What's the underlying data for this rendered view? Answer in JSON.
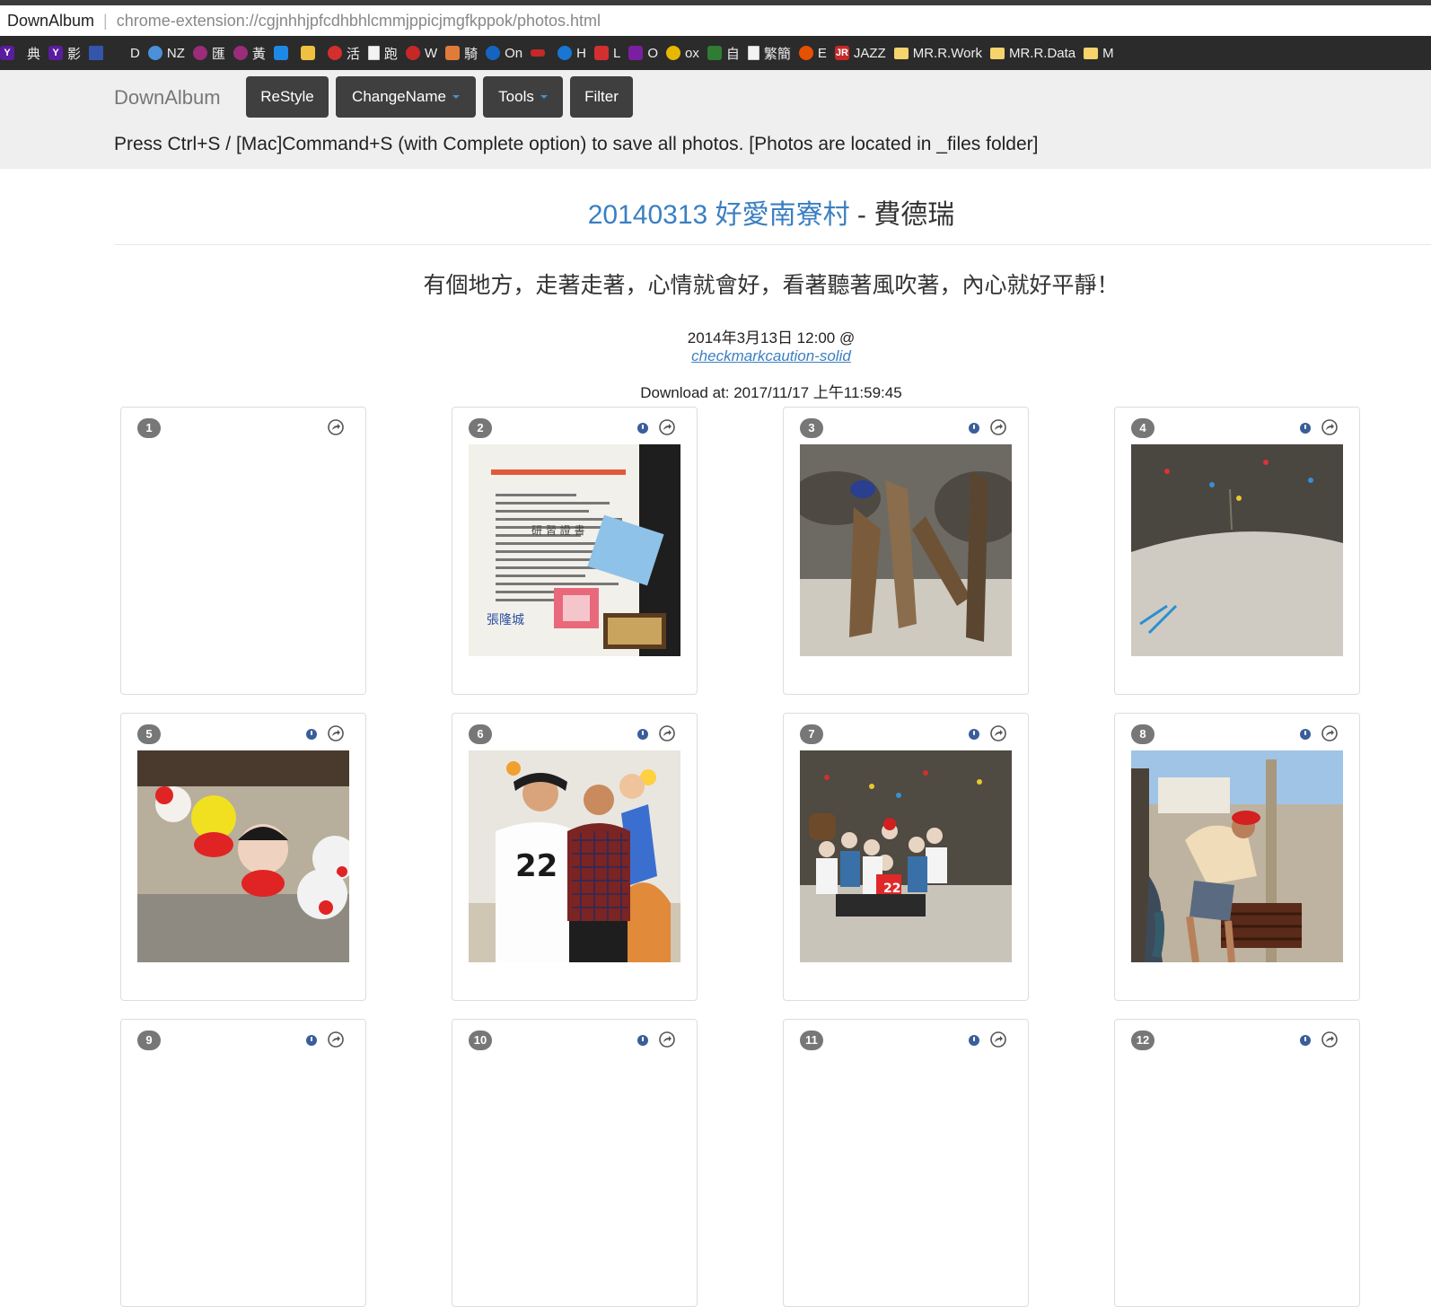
{
  "browser": {
    "site_name": "DownAlbum",
    "url": "chrome-extension://cgjnhhjpfcdhbhlcmmjppicjmgfkppok/photos.html",
    "bookmarks": [
      {
        "label": "典",
        "icon": "yahoo-icon",
        "color": "#5b1d9f"
      },
      {
        "label": "影",
        "icon": "yahoo-icon",
        "color": "#5b1d9f"
      },
      {
        "label": "",
        "icon": "flag-icon",
        "color": "#3355aa"
      },
      {
        "label": "D",
        "icon": "blank-icon",
        "color": "#2b2b2b"
      },
      {
        "label": "NZ",
        "icon": "cloud-icon",
        "color": "#4a90d9"
      },
      {
        "label": "匯",
        "icon": "circle-char-icon",
        "color": "#9b2c7a"
      },
      {
        "label": "黃",
        "icon": "circle-char-icon",
        "color": "#9b2c7a"
      },
      {
        "label": "",
        "icon": "cube-icon",
        "color": "#1e88e5"
      },
      {
        "label": "",
        "icon": "card-icon",
        "color": "#f0c040"
      },
      {
        "label": "活",
        "icon": "target-icon",
        "color": "#d32f2f"
      },
      {
        "label": "跑",
        "icon": "page-icon",
        "color": "#f3f3f3"
      },
      {
        "label": "W",
        "icon": "shield-icon",
        "color": "#c62828"
      },
      {
        "label": "騎",
        "icon": "rider-icon",
        "color": "#e07b39"
      },
      {
        "label": "On",
        "icon": "onedrive-icon",
        "color": "#1565c0"
      },
      {
        "label": "",
        "icon": "red-flag-icon",
        "color": "#c62828"
      },
      {
        "label": "H",
        "icon": "globe-icon",
        "color": "#1976d2"
      },
      {
        "label": "L",
        "icon": "live-icon",
        "color": "#d32f2f"
      },
      {
        "label": "O",
        "icon": "onenote-icon",
        "color": "#7b1fa2"
      },
      {
        "label": "ox",
        "icon": "dots-icon",
        "color": "#e6b800"
      },
      {
        "label": "自",
        "icon": "green-icon",
        "color": "#2e7d32"
      },
      {
        "label": "繁簡",
        "icon": "page-icon",
        "color": "#f3f3f3"
      },
      {
        "label": "E",
        "icon": "flame-icon",
        "color": "#e65100"
      },
      {
        "label": "JAZZ",
        "icon": "jr-icon",
        "color": "#c62828"
      },
      {
        "label": "MR.R.Work",
        "icon": "folder-icon",
        "color": "#f6d36b"
      },
      {
        "label": "MR.R.Data",
        "icon": "folder-icon",
        "color": "#f6d36b"
      },
      {
        "label": "M",
        "icon": "folder-icon",
        "color": "#f6d36b"
      }
    ]
  },
  "navbar": {
    "brand": "DownAlbum",
    "buttons": [
      "ReStyle",
      "ChangeName",
      "Tools",
      "Filter"
    ],
    "save_note": "Press Ctrl+S / [Mac]Command+S (with Complete option) to save all photos. [Photos are located in _files folder]"
  },
  "album": {
    "date_link": "20140313",
    "name_link": "好愛南寮村",
    "separator": " - ",
    "owner": "費德瑞",
    "description": "有個地方，走著走著，心情就會好，看著聽著風吹著，內心就好平靜！",
    "datetime": "2014年3月13日 12:00 @",
    "author_link": "checkmarkcaution-solid",
    "download_at": "Download at: 2017/11/17 上午11:59:45"
  },
  "photos": [
    {
      "number": "1",
      "has_info": false,
      "has_image": false,
      "scene": "none"
    },
    {
      "number": "2",
      "has_info": true,
      "has_image": true,
      "scene": "certificate"
    },
    {
      "number": "3",
      "has_info": true,
      "has_image": true,
      "scene": "driftwood figure"
    },
    {
      "number": "4",
      "has_info": true,
      "has_image": true,
      "scene": "stone wall path"
    },
    {
      "number": "5",
      "has_info": true,
      "has_image": true,
      "scene": "painted figurines"
    },
    {
      "number": "6",
      "has_info": true,
      "has_image": true,
      "scene": "two men mural"
    },
    {
      "number": "7",
      "has_info": true,
      "has_image": true,
      "scene": "group photo"
    },
    {
      "number": "8",
      "has_info": true,
      "has_image": true,
      "scene": "man at pump"
    },
    {
      "number": "9",
      "has_info": true,
      "has_image": false,
      "scene": "cut off"
    },
    {
      "number": "10",
      "has_info": true,
      "has_image": false,
      "scene": "cut off"
    },
    {
      "number": "11",
      "has_info": true,
      "has_image": false,
      "scene": "cut off"
    },
    {
      "number": "12",
      "has_info": true,
      "has_image": false,
      "scene": "cut off"
    }
  ],
  "colors": {
    "link": "#3a7fc1",
    "nav_button": "#3f3f3f",
    "badge": "#777777",
    "navbar_bg": "#efefef"
  }
}
